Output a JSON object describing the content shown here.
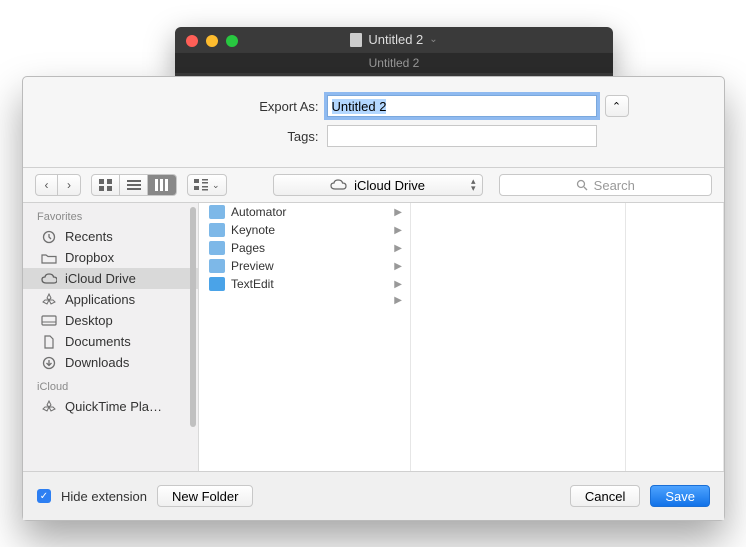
{
  "parent_window": {
    "title": "Untitled 2",
    "subtitle": "Untitled 2"
  },
  "form": {
    "export_as_label": "Export As:",
    "export_as_value": "Untitled 2",
    "tags_label": "Tags:",
    "tags_value": ""
  },
  "toolbar": {
    "location_label": "iCloud Drive",
    "search_placeholder": "Search"
  },
  "sidebar": {
    "sections": [
      {
        "header": "Favorites",
        "items": [
          {
            "icon": "clock-icon",
            "label": "Recents",
            "selected": false
          },
          {
            "icon": "folder-icon",
            "label": "Dropbox",
            "selected": false
          },
          {
            "icon": "cloud-icon",
            "label": "iCloud Drive",
            "selected": true
          },
          {
            "icon": "app-icon",
            "label": "Applications",
            "selected": false
          },
          {
            "icon": "desktop-icon",
            "label": "Desktop",
            "selected": false
          },
          {
            "icon": "document-icon",
            "label": "Documents",
            "selected": false
          },
          {
            "icon": "download-icon",
            "label": "Downloads",
            "selected": false
          }
        ]
      },
      {
        "header": "iCloud",
        "items": [
          {
            "icon": "app-icon",
            "label": "QuickTime Pla…",
            "selected": false
          }
        ]
      }
    ]
  },
  "column1": {
    "items": [
      {
        "label": "Automator",
        "has_children": true
      },
      {
        "label": "Keynote",
        "has_children": true
      },
      {
        "label": "Pages",
        "has_children": true
      },
      {
        "label": "Preview",
        "has_children": true
      },
      {
        "label": "TextEdit",
        "has_children": true
      }
    ]
  },
  "bottom": {
    "hide_extension_checked": true,
    "hide_extension_label": "Hide extension",
    "new_folder_label": "New Folder",
    "cancel_label": "Cancel",
    "save_label": "Save"
  }
}
